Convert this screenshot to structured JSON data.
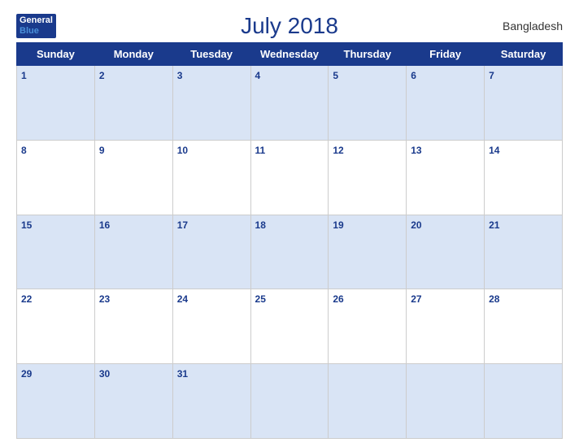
{
  "header": {
    "logo_line1": "General",
    "logo_line2": "Blue",
    "title": "July 2018",
    "country": "Bangladesh"
  },
  "weekdays": [
    "Sunday",
    "Monday",
    "Tuesday",
    "Wednesday",
    "Thursday",
    "Friday",
    "Saturday"
  ],
  "weeks": [
    [
      1,
      2,
      3,
      4,
      5,
      6,
      7
    ],
    [
      8,
      9,
      10,
      11,
      12,
      13,
      14
    ],
    [
      15,
      16,
      17,
      18,
      19,
      20,
      21
    ],
    [
      22,
      23,
      24,
      25,
      26,
      27,
      28
    ],
    [
      29,
      30,
      31,
      null,
      null,
      null,
      null
    ]
  ]
}
